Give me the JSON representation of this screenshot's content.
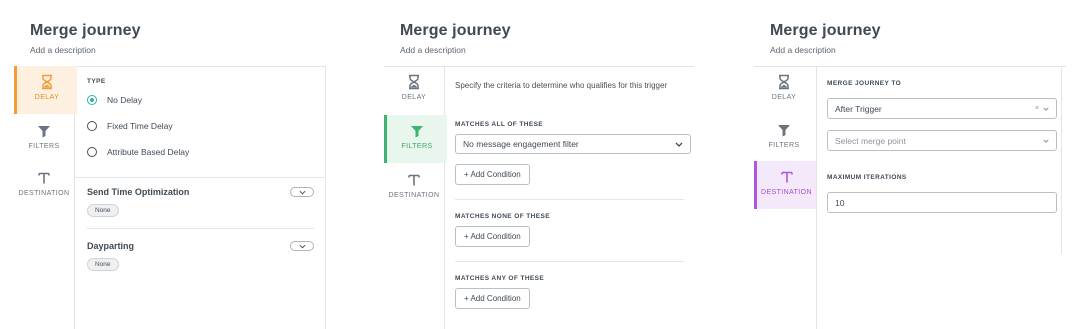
{
  "panels": [
    {
      "title": "Merge journey",
      "description": "Add a description",
      "tabs": {
        "delay": "DELAY",
        "filters": "FILTERS",
        "destination": "DESTINATION"
      },
      "type_heading": "TYPE",
      "radios": [
        "No Delay",
        "Fixed Time Delay",
        "Attribute Based Delay"
      ],
      "selected_radio": "No Delay",
      "send_time": {
        "label": "Send Time Optimization",
        "value": "None"
      },
      "dayparting": {
        "label": "Dayparting",
        "value": "None"
      }
    },
    {
      "title": "Merge journey",
      "description": "Add a description",
      "tabs": {
        "delay": "DELAY",
        "filters": "FILTERS",
        "destination": "DESTINATION"
      },
      "criteria_text": "Specify the criteria to determine who qualifies for this trigger",
      "matches_all_heading": "MATCHES ALL OF THESE",
      "matches_all_select": "No message engagement filter",
      "matches_none_heading": "MATCHES NONE OF THESE",
      "matches_any_heading": "MATCHES ANY OF THESE",
      "add_condition": "+ Add Condition"
    },
    {
      "title": "Merge journey",
      "description": "Add a description",
      "tabs": {
        "delay": "DELAY",
        "filters": "FILTERS",
        "destination": "DESTINATION"
      },
      "merge_to_heading": "MERGE JOURNEY TO",
      "merge_to_value": "After Trigger",
      "merge_point_placeholder": "Select merge point",
      "max_iter_heading": "MAXIMUM ITERATIONS",
      "max_iter_value": "10"
    }
  ],
  "colors": {
    "delay_accent": "#f29d38",
    "filters_accent": "#3fb46e",
    "destination_accent": "#b255dd",
    "radio_checked": "#35b3a3"
  },
  "icons": {
    "delay": "hourglass-icon",
    "filters": "funnel-icon",
    "destination": "merge-arrow-icon",
    "dropdown": "chevron-down-icon",
    "clear": "close-icon"
  }
}
